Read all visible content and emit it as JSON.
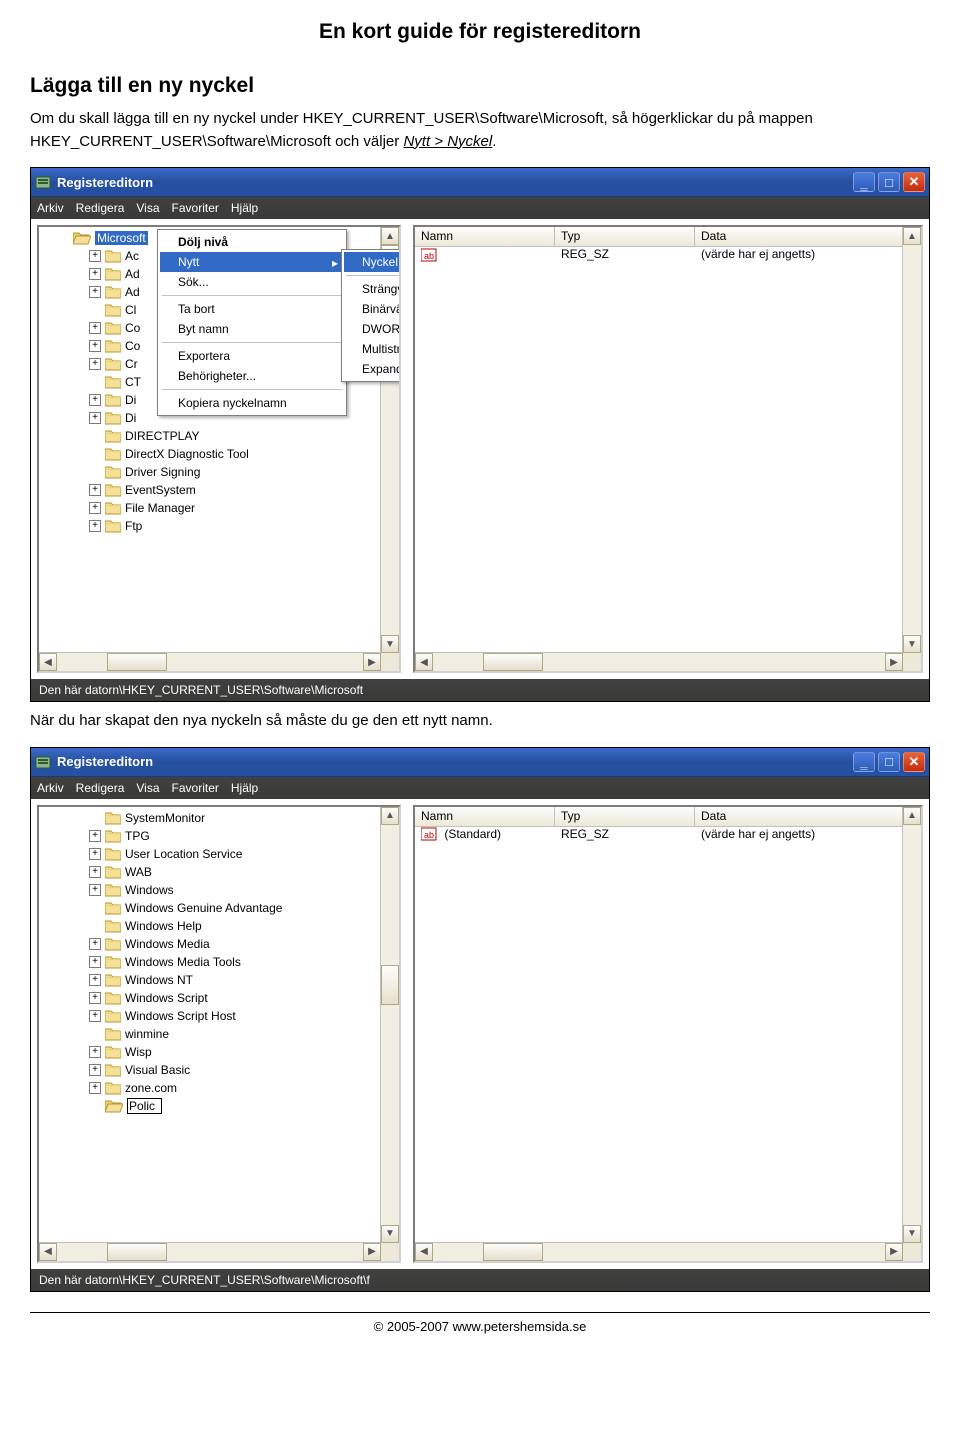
{
  "doc_title": "En kort guide för registereditorn",
  "section_title": "Lägga till en ny nyckel",
  "para1_a": "Om du skall lägga till en ny nyckel under HKEY_CURRENT_USER\\Software\\Microsoft, så högerklickar du på mappen HKEY_CURRENT_USER\\Software\\Microsoft och väljer ",
  "para1_b": "Nytt > Nyckel",
  "para1_c": ".",
  "para2": "När du har skapat den nya nyckeln så måste du ge den ett nytt namn.",
  "window1": {
    "title": "Registereditorn",
    "menubar": [
      "Arkiv",
      "Redigera",
      "Visa",
      "Favoriter",
      "Hjälp"
    ],
    "status": "Den här datorn\\HKEY_CURRENT_USER\\Software\\Microsoft",
    "tree_selected": "Microsoft",
    "tree_items": [
      {
        "exp": true,
        "lbl": "Ac"
      },
      {
        "exp": true,
        "lbl": "Ad"
      },
      {
        "exp": true,
        "lbl": "Ad"
      },
      {
        "exp": false,
        "lbl": "Cl"
      },
      {
        "exp": true,
        "lbl": "Co"
      },
      {
        "exp": true,
        "lbl": "Co"
      },
      {
        "exp": true,
        "lbl": "Cr"
      },
      {
        "exp": false,
        "lbl": "CT"
      },
      {
        "exp": true,
        "lbl": "Di"
      },
      {
        "exp": true,
        "lbl": "Di"
      },
      {
        "exp": false,
        "lbl": "DIRECTPLAY"
      },
      {
        "exp": false,
        "lbl": "DirectX Diagnostic Tool"
      },
      {
        "exp": false,
        "lbl": "Driver Signing"
      },
      {
        "exp": true,
        "lbl": "EventSystem"
      },
      {
        "exp": true,
        "lbl": "File Manager"
      },
      {
        "exp": true,
        "lbl": "Ftp"
      }
    ],
    "right_cols": [
      "Namn",
      "Typ",
      "Data"
    ],
    "right_row": {
      "typ": "REG_SZ",
      "data": "(värde har ej angetts)"
    },
    "ctx1": [
      "Dölj nivå",
      "Nytt",
      "Sök...",
      "Ta bort",
      "Byt namn",
      "Exportera",
      "Behörigheter...",
      "Kopiera nyckelnamn"
    ],
    "ctx2": [
      "Nyckel",
      "Strängvärde",
      "Binärvärde",
      "DWORD-värde",
      "Multisträngvärde",
      "Expanderbart strängvärde"
    ]
  },
  "window2": {
    "title": "Registereditorn",
    "menubar": [
      "Arkiv",
      "Redigera",
      "Visa",
      "Favoriter",
      "Hjälp"
    ],
    "status": "Den här datorn\\HKEY_CURRENT_USER\\Software\\Microsoft\\f",
    "tree_items": [
      {
        "exp": false,
        "lbl": "SystemMonitor"
      },
      {
        "exp": true,
        "lbl": "TPG"
      },
      {
        "exp": true,
        "lbl": "User Location Service"
      },
      {
        "exp": true,
        "lbl": "WAB"
      },
      {
        "exp": true,
        "lbl": "Windows"
      },
      {
        "exp": false,
        "lbl": "Windows Genuine Advantage"
      },
      {
        "exp": false,
        "lbl": "Windows Help"
      },
      {
        "exp": true,
        "lbl": "Windows Media"
      },
      {
        "exp": true,
        "lbl": "Windows Media Tools"
      },
      {
        "exp": true,
        "lbl": "Windows NT"
      },
      {
        "exp": true,
        "lbl": "Windows Script"
      },
      {
        "exp": true,
        "lbl": "Windows Script Host"
      },
      {
        "exp": false,
        "lbl": "winmine"
      },
      {
        "exp": true,
        "lbl": "Wisp"
      },
      {
        "exp": true,
        "lbl": "Visual Basic"
      },
      {
        "exp": true,
        "lbl": "zone.com"
      }
    ],
    "editing_label": "Polic",
    "right_cols": [
      "Namn",
      "Typ",
      "Data"
    ],
    "right_row": {
      "name": "(Standard)",
      "typ": "REG_SZ",
      "data": "(värde har ej angetts)"
    }
  },
  "footer": "© 2005-2007 www.petershemsida.se"
}
